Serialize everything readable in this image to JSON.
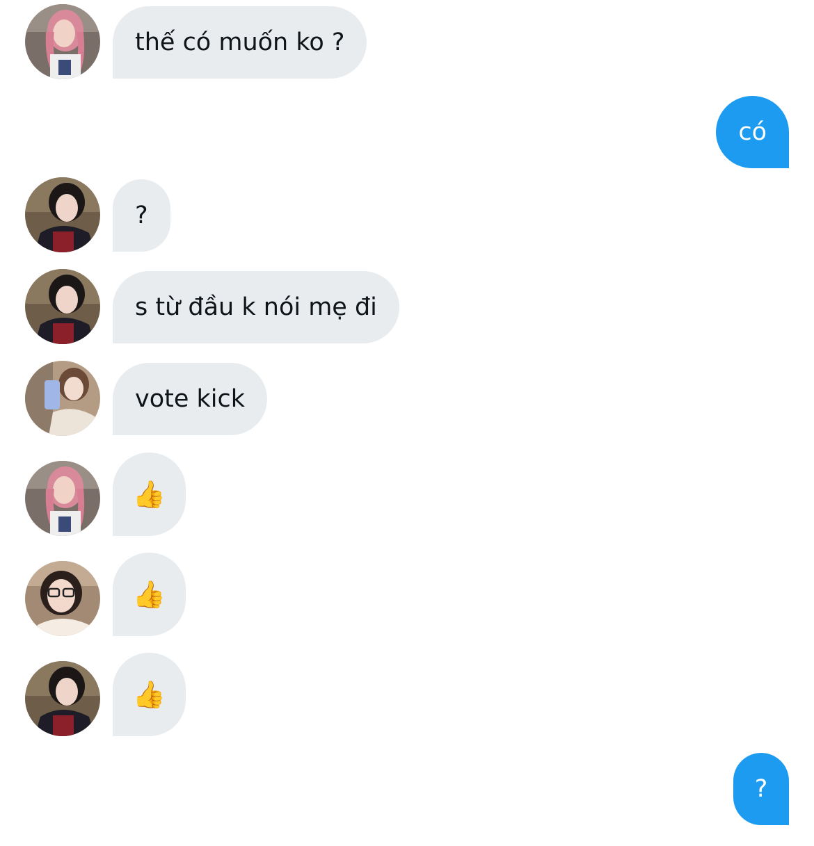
{
  "conversation": {
    "messages": [
      {
        "sender": "incoming",
        "avatar": "pink-hair-avatar",
        "text": "thế có muốn ko ?"
      },
      {
        "sender": "outgoing",
        "text": "có"
      },
      {
        "sender": "incoming",
        "avatar": "dark-hair-avatar",
        "text": "?"
      },
      {
        "sender": "incoming",
        "avatar": "dark-hair-avatar",
        "text": "s từ đầu k nói mẹ đi"
      },
      {
        "sender": "incoming",
        "avatar": "mirror-selfie-avatar",
        "text": "vote kick"
      },
      {
        "sender": "incoming",
        "avatar": "pink-hair-avatar",
        "text": "👍"
      },
      {
        "sender": "incoming",
        "avatar": "glasses-avatar",
        "text": "👍"
      },
      {
        "sender": "incoming",
        "avatar": "dark-hair-avatar",
        "text": "👍"
      },
      {
        "sender": "outgoing",
        "text": "?"
      }
    ]
  },
  "colors": {
    "incoming_bubble": "#e8ecef",
    "outgoing_bubble": "#1d9bf0",
    "incoming_text": "#0f1419",
    "outgoing_text": "#ffffff"
  }
}
